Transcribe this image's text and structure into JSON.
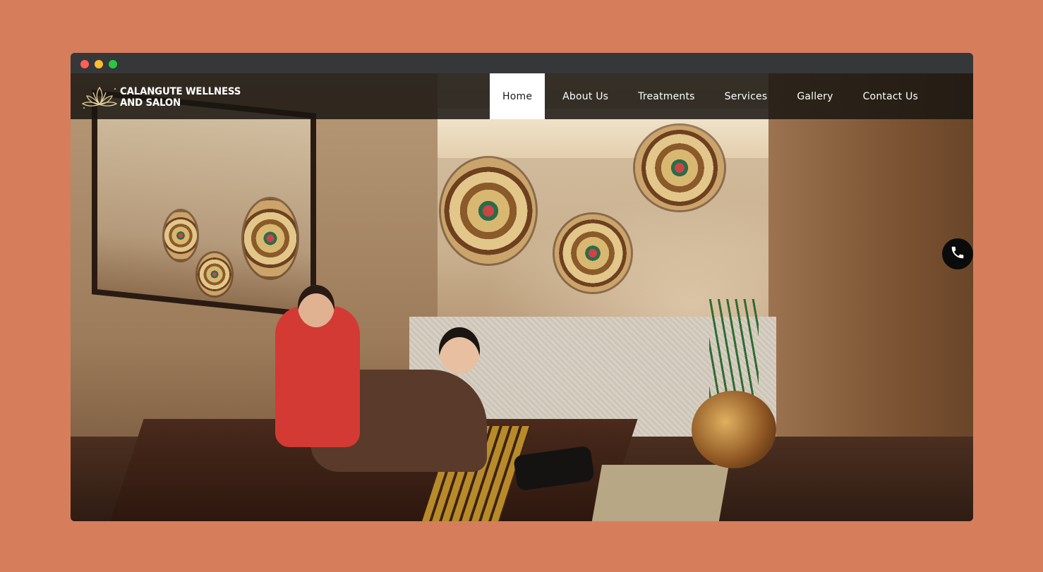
{
  "window": {
    "controls": [
      "close",
      "minimize",
      "maximize"
    ]
  },
  "brand": {
    "line1": "CALANGUTE WELLNESS",
    "line2": "AND SALON",
    "icon": "lotus-icon"
  },
  "nav": {
    "items": [
      {
        "label": "Home",
        "active": true
      },
      {
        "label": "About Us",
        "active": false
      },
      {
        "label": "Treatments",
        "active": false
      },
      {
        "label": "Services",
        "active": false
      },
      {
        "label": "Gallery",
        "active": false
      },
      {
        "label": "Contact Us",
        "active": false
      }
    ]
  },
  "floating": {
    "call_icon": "phone-icon"
  },
  "colors": {
    "page_background": "#d67e5c",
    "titlebar": "#363739",
    "nav_background": "#1a1612",
    "active_tab": "#ffffff",
    "call_button": "#0b0b0b"
  }
}
